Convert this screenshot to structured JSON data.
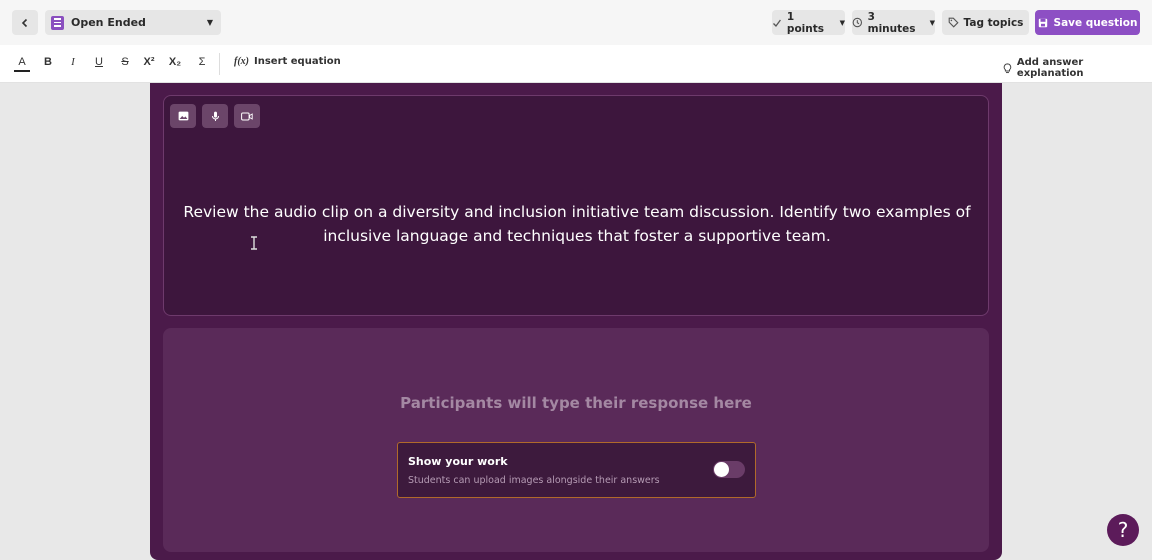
{
  "header": {
    "question_type": "Open Ended",
    "points": "1 points",
    "time": "3 minutes",
    "tag_topics": "Tag topics",
    "save": "Save question"
  },
  "toolbar": {
    "color": "A",
    "bold": "B",
    "italic": "I",
    "underline": "U",
    "strike": "S",
    "superscript": "X²",
    "subscript": "X₂",
    "sigma": "Σ",
    "fx": "f(x)",
    "insert_equation": "Insert equation",
    "answer_explanation": "Add answer explanation"
  },
  "question": {
    "text": "Review the audio clip on a diversity and inclusion initiative team discussion. Identify two examples of inclusive language and techniques that foster a supportive team."
  },
  "answer": {
    "placeholder": "Participants will type their response here",
    "show_work_title": "Show your work",
    "show_work_subtitle": "Students can upload images alongside their answers",
    "show_work_enabled": false
  },
  "help": {
    "label": "?"
  },
  "icons": [
    "chevron-left-icon",
    "open-ended-icon",
    "chevron-down-icon",
    "check-icon",
    "clock-icon",
    "tag-icon",
    "save-icon",
    "image-icon",
    "microphone-icon",
    "video-icon",
    "lightbulb-icon",
    "text-cursor-icon"
  ],
  "colors": {
    "accent": "#8d4fc4",
    "card": "#4b1a4a",
    "question_bg": "#3d163d",
    "answer_bg": "#5a2a59",
    "show_work_border": "#b06a2a"
  }
}
